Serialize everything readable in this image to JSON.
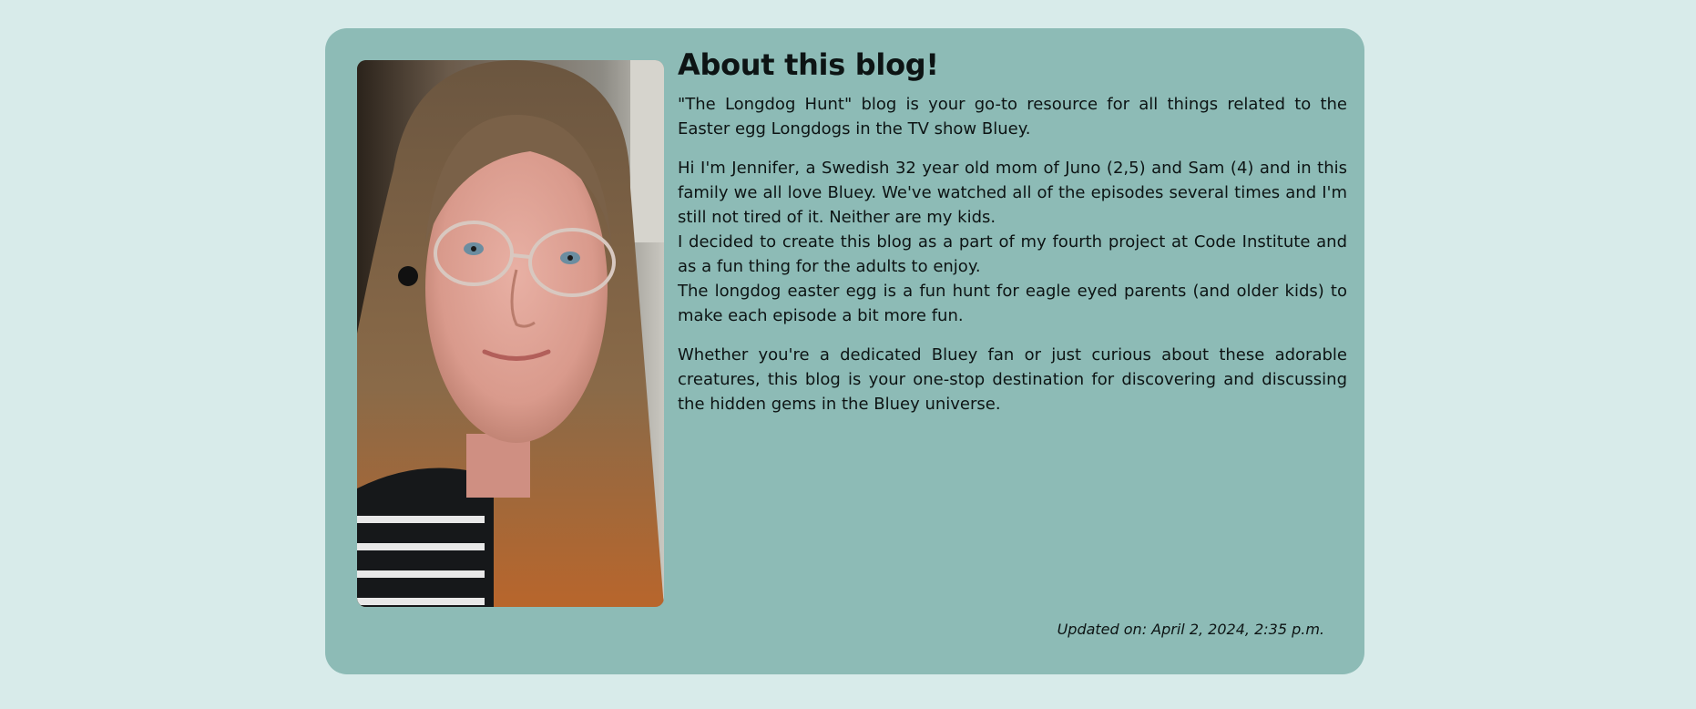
{
  "about": {
    "title": "About this blog!",
    "intro": "\"The Longdog Hunt\" blog is your go-to resource for all things related to the Easter egg Longdogs in the TV show Bluey.",
    "bio_lines": [
      "Hi I'm Jennifer, a Swedish 32 year old mom of Juno (2,5) and Sam (4) and in this family we all love Bluey. We've watched all of the episodes several times and I'm still not tired of it. Neither are my kids.",
      "I decided to create this blog as a part of my fourth project at Code Institute and as a fun thing for the adults to enjoy.",
      "The longdog easter egg is a fun hunt for eagle eyed parents (and older kids) to make each episode a bit more fun."
    ],
    "closing": "Whether you're a dedicated Bluey fan or just curious about these adorable creatures, this blog is your one-stop destination for discovering and discussing the hidden gems in the Bluey universe.",
    "updated": "Updated on: April 2, 2024, 2:35 p.m."
  },
  "colors": {
    "page_background": "#d8ebea",
    "card_background": "#8dbbb6",
    "text": "#0d1414"
  },
  "photo": {
    "subject": "author-portrait-photo"
  }
}
